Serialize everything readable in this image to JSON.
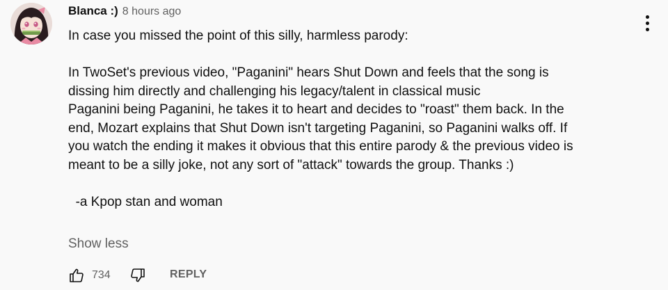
{
  "comment": {
    "author": "Blanca :)",
    "timestamp": "8 hours ago",
    "text": "In case you missed the point of this silly, harmless parody:\n\nIn TwoSet's previous video, \"Paganini\" hears Shut Down and feels that the song is\ndissing him directly and challenging his legacy/talent in classical music\nPaganini being Paganini, he takes it to heart and decides to \"roast\" them back. In the\nend, Mozart explains that Shut Down isn't targeting Paganini, so Paganini walks off. If\nyou watch the ending it makes it obvious that this entire parody & the previous video is\nmeant to be a silly joke, not any sort of \"attack\" towards the group. Thanks :)\n\n  -a Kpop stan and woman",
    "show_less_label": "Show less",
    "like_count": "734",
    "reply_label": "REPLY"
  },
  "icons": {
    "avatar": "avatar",
    "like": "thumbs-up-icon",
    "dislike": "thumbs-down-icon",
    "menu": "more-vert-icon"
  },
  "colors": {
    "background": "#f9f9f9",
    "text_primary": "#0f0f0f",
    "text_secondary": "#606060"
  }
}
